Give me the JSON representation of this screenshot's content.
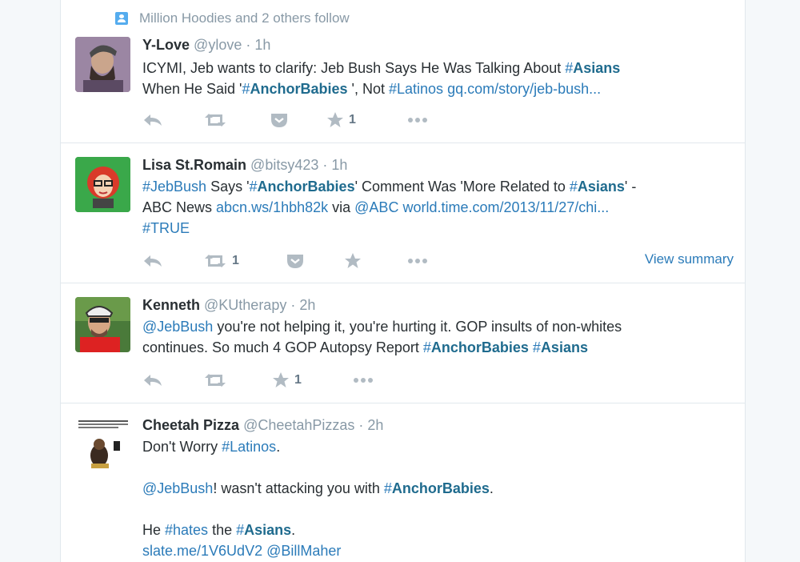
{
  "context": {
    "text": "Million Hoodies and 2 others follow"
  },
  "tweets": [
    {
      "name": "Y-Love",
      "handle": "@ylove",
      "time": "· 1h",
      "likes": "1",
      "line1": {
        "t1": "ICYMI, Jeb wants to clarify: Jeb Bush Says He Was Talking About ",
        "tag1": "Asians"
      },
      "line2": {
        "t1": "When He Said '",
        "tag1": "AnchorBabies",
        "t2": " ', Not ",
        "tag2": "#Latinos",
        "link1": "gq.com/story/jeb-bush..."
      }
    },
    {
      "name": "Lisa St.Romain",
      "handle": "@bitsy423",
      "time": "· 1h",
      "retweets": "1",
      "summary": "View summary",
      "line1": {
        "tag1": "#JebBush",
        "t1": " Says '",
        "tag2": "AnchorBabies",
        "t2": "' Comment Was 'More Related to ",
        "tag3": "Asians",
        "t3": "' -"
      },
      "line2": {
        "t1": "ABC News ",
        "link1": "abcn.ws/1hbh82k",
        "t2": " via ",
        "link2": "@ABC",
        "t3": " ",
        "link3": "world.time.com/2013/11/27/chi..."
      },
      "line3": {
        "tag1": "#TRUE"
      }
    },
    {
      "name": "Kenneth",
      "handle": "@KUtherapy",
      "time": "· 2h",
      "likes": "1",
      "line1": {
        "link1": "@JebBush",
        "t1": " you're not helping it, you're hurting it. GOP insults of non-whites"
      },
      "line2": {
        "t1": "continues. So much 4 GOP Autopsy Report ",
        "tag1": "AnchorBabies",
        "tag2": "Asians"
      }
    },
    {
      "name": "Cheetah Pizza",
      "handle": "@CheetahPizzas",
      "time": "· 2h",
      "line1": {
        "t1": "Don't Worry ",
        "tag1": "#Latinos",
        "t2": "."
      },
      "line2": {
        "link1": "@JebBush",
        "t1": "! wasn't attacking you with ",
        "tag1": "AnchorBabies",
        "t2": "."
      },
      "line3": {
        "t1": "He ",
        "tag1": "#hates",
        "t2": " the ",
        "tag2": "Asians",
        "t3": "."
      },
      "line4": {
        "link1": "slate.me/1V6UdV2",
        "t1": " ",
        "link2": "@BillMaher"
      },
      "avatar_caption": "CHEETAHPIZZA WILL TORTURE PARTISANS WITH JOHN KAHE GRENADE UNTIL YOU GIVE"
    }
  ]
}
